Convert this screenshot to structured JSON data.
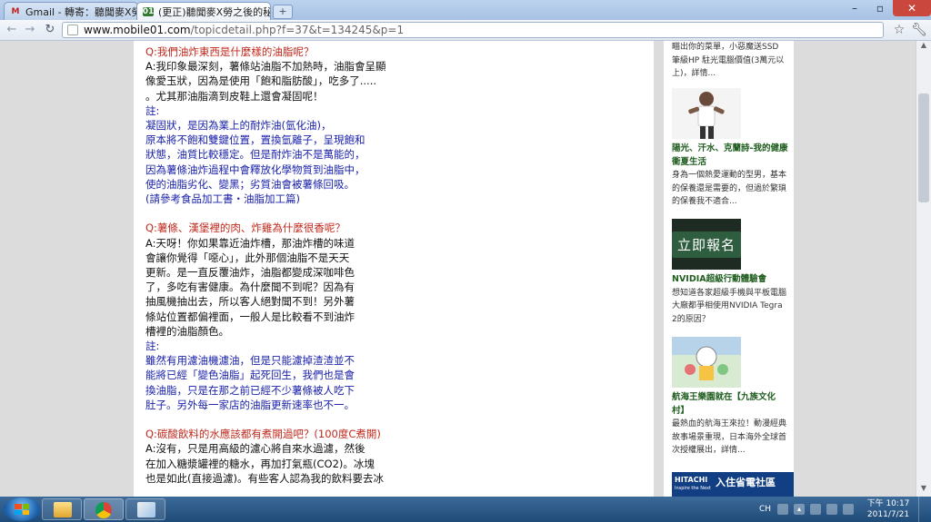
{
  "browser": {
    "tabs": [
      {
        "title": "Gmail - 轉寄：聽聞麥X勞"
      },
      {
        "title": "(更正)聽聞麥X勞之後的秘"
      }
    ],
    "url_host": "www.mobile01.com",
    "url_path": "/topicdetail.php?f=37&t=134245&p=1"
  },
  "post": {
    "lines": [
      {
        "style": "q",
        "text": "Q:我們油炸東西是什麼樣的油脂呢？"
      },
      {
        "style": "a",
        "text": "A:我印象最深刻，薯條站油脂不加熱時，油脂會呈顯"
      },
      {
        "style": "a",
        "text": "像愛玉狀，因為是使用「飽和脂肪酸」，吃多了....."
      },
      {
        "style": "a",
        "text": "。尤其那油脂滴到皮鞋上還會凝固呢！"
      },
      {
        "style": "n",
        "text": "註:"
      },
      {
        "style": "n",
        "text": "凝固狀，是因為業上的耐炸油(氫化油)，"
      },
      {
        "style": "n",
        "text": "原本將不飽和雙鍵位置，置換氫離子，呈現飽和"
      },
      {
        "style": "n",
        "text": "狀態，油質比較穩定。但是耐炸油不是萬能的，"
      },
      {
        "style": "n",
        "text": "因為薯條油炸過程中會釋放化學物質到油脂中，"
      },
      {
        "style": "n",
        "text": "使的油脂劣化、變黑；劣質油會被薯條回吸。"
      },
      {
        "style": "n",
        "text": "(請參考食品加工書・油脂加工篇)"
      },
      {
        "style": "gap",
        "text": ""
      },
      {
        "style": "q",
        "text": "Q:薯條、漢堡裡的肉、炸雞為什麼很香呢？"
      },
      {
        "style": "a",
        "text": "A:天呀！你如果靠近油炸槽，那油炸槽的味道"
      },
      {
        "style": "a",
        "text": "會讓你覺得「噁心」，此外那個油脂不是天天"
      },
      {
        "style": "a",
        "text": "更新。是一直反覆油炸，油脂都變成深咖啡色"
      },
      {
        "style": "a",
        "text": "了，多吃有害健康。為什麼聞不到呢？因為有"
      },
      {
        "style": "a",
        "text": "抽風機抽出去，所以客人絕對聞不到！另外薯"
      },
      {
        "style": "a",
        "text": "條站位置都偏裡面，一般人是比較看不到油炸"
      },
      {
        "style": "a",
        "text": "槽裡的油脂顏色。"
      },
      {
        "style": "n",
        "text": "註:"
      },
      {
        "style": "n",
        "text": "雖然有用濾油機濾油，但是只能濾掉渣渣並不"
      },
      {
        "style": "n",
        "text": "能將已經「變色油脂」起死回生，我們也是會"
      },
      {
        "style": "n",
        "text": "換油脂，只是在那之前已經不少薯條被人吃下"
      },
      {
        "style": "n",
        "text": "肚子。另外每一家店的油脂更新速率也不一。"
      },
      {
        "style": "gap",
        "text": ""
      },
      {
        "style": "q",
        "text": "Q:碳酸飲料的水應該都有煮開過吧？(100度C煮開)"
      },
      {
        "style": "a",
        "text": "A:沒有，只是用高級的濾心將自來水過濾，然後"
      },
      {
        "style": "a",
        "text": "在加入糖漿罐裡的糖水，再加打氣瓶(CO2)。冰塊"
      },
      {
        "style": "a",
        "text": "也是如此(直接過濾)。有些客人認為我的飲料要去冰"
      }
    ]
  },
  "sidebar": {
    "top_text": [
      "瞄出你的菜單，小惡魔送SSD",
      "筆級HP 駐光電腦價值(3萬元以",
      "上)，詳情..."
    ],
    "items": [
      {
        "title": "陽光、汗水、克蘭詩-我的健康衝夏生活",
        "desc": "身為一個熱愛運動的型男，基本的保養還是需要的，但過於繁瑣的保養我不適合..."
      },
      {
        "title": "NVIDIA超級行動體驗會",
        "desc": "想知道各家超級手機與平板電腦大廠都爭相使用NVIDIA Tegra 2的原因？",
        "image_text": "立即報名"
      },
      {
        "title": "航海王樂園就在【九族文化村】",
        "desc": "最熱血的航海王來拉！動漫經典故事場景重現，日本海外全球首次授權展出，詳情..."
      }
    ],
    "banner_left": "HITACHI",
    "banner_sub": "Inspire the Next",
    "banner_right": "入住省電社區"
  },
  "taskbar": {
    "lang": "CH",
    "time": "下午 10:17",
    "date": "2011/7/21"
  }
}
